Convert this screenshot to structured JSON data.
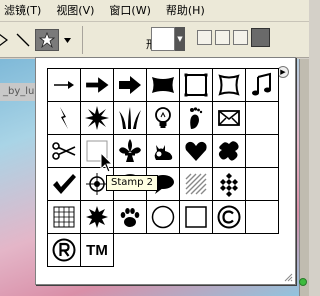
{
  "menubar": {
    "items": [
      "滤镜(T)",
      "视图(V)",
      "窗口(W)",
      "帮助(H)"
    ]
  },
  "options_bar": {
    "shape_label": "形状:"
  },
  "canvas": {
    "doc_tab_text": "_by_lu"
  },
  "shape_picker": {
    "menu_icon": "right-arrow-circle-icon",
    "shapes": [
      "arrow-thin-icon",
      "arrow-medium-icon",
      "arrow-bold-icon",
      "banner-icon",
      "frame-square-icon",
      "frame-rounded-icon",
      "music-notes-icon",
      "lightning-icon",
      "starburst-icon",
      "grass-icon",
      "lightbulb-icon",
      "foot-icon",
      "envelope-icon",
      "",
      "scissors-icon",
      "stamp-2",
      "fleur-de-lis-icon",
      "cat-icon",
      "heart-icon",
      "blob-icon",
      "",
      "checkmark-icon",
      "target-icon",
      "speech-bubble-icon",
      "speech-bubble-filled-icon",
      "diagonal-stripes-icon",
      "checker-icon",
      "",
      "grid-icon",
      "burst-icon",
      "paw-icon",
      "circle-icon",
      "square-icon",
      "copyright-icon",
      "",
      "registered-icon",
      "trademark-icon"
    ],
    "tooltip": "Stamp 2",
    "tm_text": "TM"
  }
}
